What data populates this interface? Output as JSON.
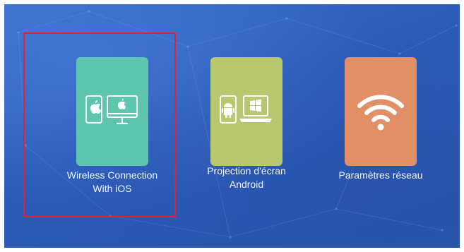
{
  "menu": {
    "items": [
      {
        "id": "ios",
        "line1": "Wireless Connection",
        "line2": "With iOS",
        "color": "#5ec6ae",
        "icons": [
          "phone-apple-icon",
          "monitor-apple-icon"
        ],
        "selected": true
      },
      {
        "id": "android",
        "line1": "Projection d'écran",
        "line2": "Android",
        "color": "#b8c86e",
        "icons": [
          "phone-android-icon",
          "laptop-windows-icon"
        ],
        "selected": false
      },
      {
        "id": "network",
        "line1": "Paramètres réseau",
        "line2": "",
        "color": "#e08f66",
        "icons": [
          "wifi-icon"
        ],
        "selected": false
      }
    ],
    "focus_color": "#e0242b",
    "background_color": "#2b5bb8"
  }
}
